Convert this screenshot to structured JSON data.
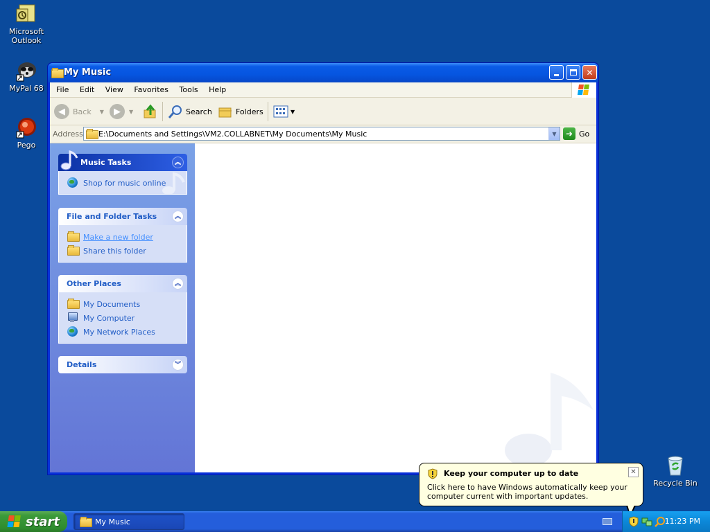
{
  "desktop": {
    "icons": [
      {
        "label": "Microsoft Outlook"
      },
      {
        "label": "MyPal 68"
      },
      {
        "label": "Pego"
      },
      {
        "label": "Recycle Bin"
      }
    ]
  },
  "window": {
    "title": "My Music",
    "menu": [
      "File",
      "Edit",
      "View",
      "Favorites",
      "Tools",
      "Help"
    ],
    "toolbar": {
      "back_label": "Back",
      "search_label": "Search",
      "folders_label": "Folders"
    },
    "address": {
      "label": "Address",
      "value": "E:\\Documents and Settings\\VM2.COLLABNET\\My Documents\\My Music",
      "go_label": "Go"
    },
    "panels": {
      "music_tasks": {
        "title": "Music Tasks",
        "items": [
          {
            "label": "Shop for music online"
          }
        ]
      },
      "file_folder_tasks": {
        "title": "File and Folder Tasks",
        "items": [
          {
            "label": "Make a new folder"
          },
          {
            "label": "Share this folder"
          }
        ]
      },
      "other_places": {
        "title": "Other Places",
        "items": [
          {
            "label": "My Documents"
          },
          {
            "label": "My Computer"
          },
          {
            "label": "My Network Places"
          }
        ]
      },
      "details": {
        "title": "Details"
      }
    }
  },
  "balloon": {
    "title": "Keep your computer up to date",
    "text": "Click here to have Windows automatically keep your computer current with important updates."
  },
  "taskbar": {
    "start_label": "start",
    "task_button_label": "My Music",
    "clock": "11:23 PM"
  },
  "colors": {
    "desktop": "#0a4a9c",
    "titlebar": "#0655e0",
    "task_link": "#215dc6",
    "start_green": "#3c9a3a",
    "balloon_bg": "#ffffe1"
  }
}
